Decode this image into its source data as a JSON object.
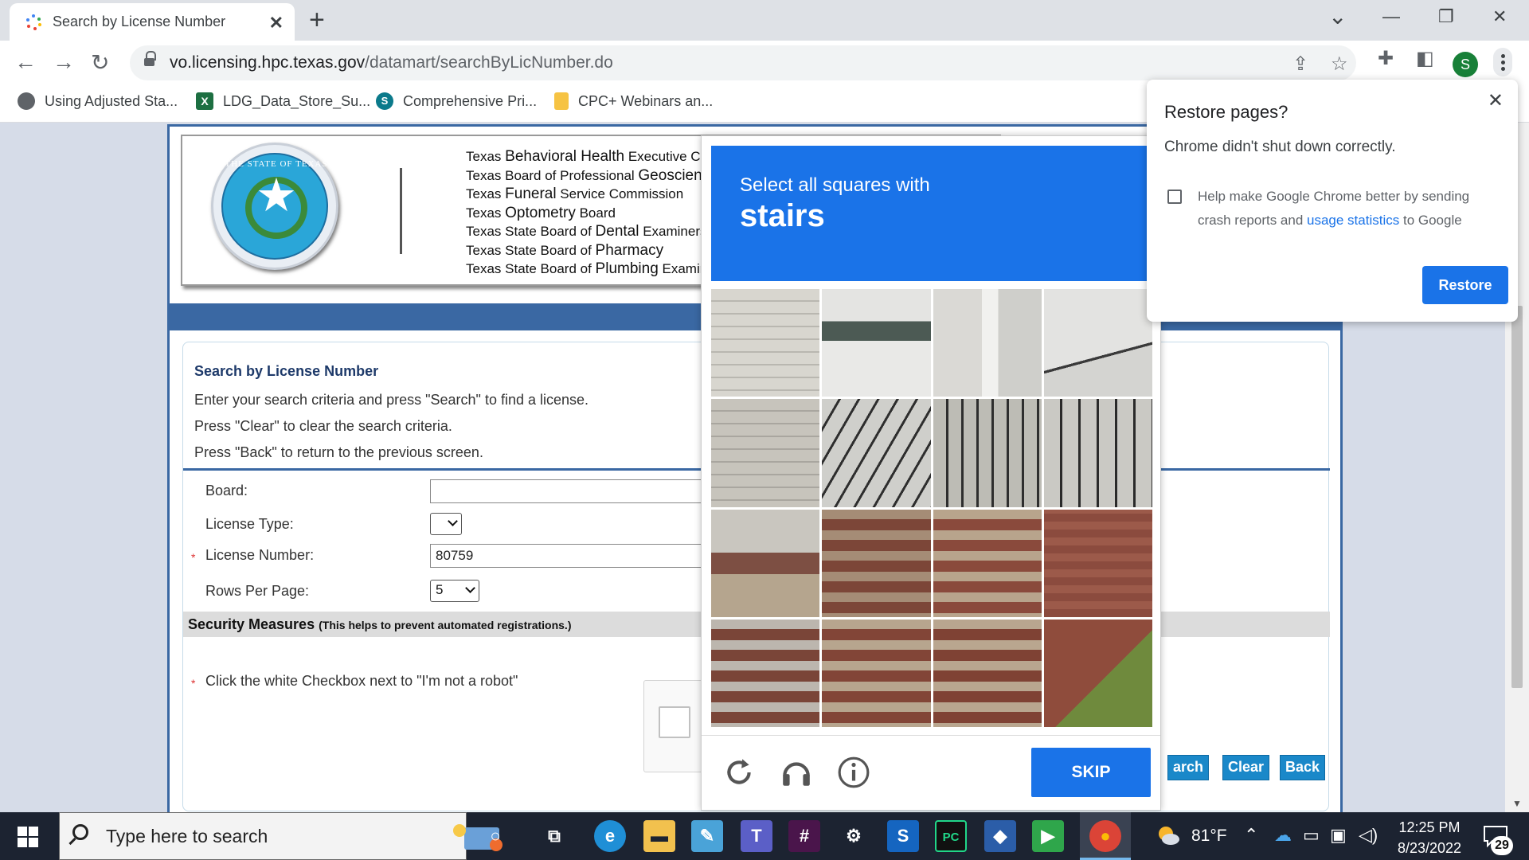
{
  "browser": {
    "tab_title": "Search by License Number",
    "tab_close": "✕",
    "new_tab": "+",
    "url_domain": "vo.licensing.hpc.texas.gov",
    "url_path": "/datamart/searchByLicNumber.do",
    "profile_initial": "S",
    "window_controls": {
      "minimize": "—",
      "restore": "❐",
      "close": "✕",
      "tab_search": "⌄"
    }
  },
  "bookmarks": [
    {
      "label": "Using Adjusted Sta...",
      "icon": "globe-icon",
      "color": "#5f6368"
    },
    {
      "label": "LDG_Data_Store_Su...",
      "icon": "excel-icon",
      "color": "#1d6f42"
    },
    {
      "label": "Comprehensive Pri...",
      "icon": "sharepoint-icon",
      "color": "#0b7a8b"
    },
    {
      "label": "CPC+ Webinars an...",
      "icon": "folder-icon",
      "color": "#f6c343"
    }
  ],
  "header": {
    "seal_text": "THE STATE OF TEXAS",
    "boards": [
      {
        "pre": "Texas ",
        "big": "Behavioral Health",
        "post": " Executive Council"
      },
      {
        "pre": "Texas Board of Professional ",
        "big": "Geoscientists",
        "post": ""
      },
      {
        "pre": "Texas ",
        "big": "Funeral",
        "post": " Service Commission"
      },
      {
        "pre": "Texas ",
        "big": "Optometry",
        "post": " Board"
      },
      {
        "pre": "Texas State Board of ",
        "big": "Dental",
        "post": " Examiners"
      },
      {
        "pre": "Texas State Board of ",
        "big": "Pharmacy",
        "post": ""
      },
      {
        "pre": "Texas State Board of ",
        "big": "Plumbing",
        "post": " Examiners"
      }
    ]
  },
  "form": {
    "title": "Search by License Number",
    "instructions": [
      "Enter your search criteria and press \"Search\" to find a license.",
      "Press \"Clear\" to clear the search criteria.",
      "Press \"Back\" to return to the previous screen."
    ],
    "board_label": "Board:",
    "board_value": "",
    "license_type_label": "License Type:",
    "license_type_value": "",
    "license_number_label": "License Number:",
    "license_number_value": "80759",
    "rows_label": "Rows Per Page:",
    "rows_value": "5",
    "security_title": "Security Measures",
    "security_sub": "(This helps to prevent automated registrations.)",
    "robot_instruction": "Click the white Checkbox next to \"I'm not a robot\"",
    "required_mark": "*",
    "buttons": {
      "search": "arch",
      "clear": "Clear",
      "back": "Back"
    }
  },
  "captcha": {
    "instruction": "Select all squares with",
    "target": "stairs",
    "skip_label": "SKIP",
    "icons": [
      "reload-icon",
      "audio-icon",
      "info-icon"
    ]
  },
  "restore_popup": {
    "title": "Restore pages?",
    "message": "Chrome didn't shut down correctly.",
    "help_pre": "Help make Google Chrome better by sending crash reports and ",
    "help_link": "usage statistics",
    "help_post": " to Google",
    "button": "Restore",
    "close": "✕"
  },
  "taskbar": {
    "search_placeholder": "Type here to search",
    "weather": "81°F",
    "time": "12:25 PM",
    "date": "8/23/2022",
    "notifications": "29",
    "apps": [
      {
        "name": "cortana-icon",
        "glyph": "○",
        "color": "#1c2331"
      },
      {
        "name": "task-view-icon",
        "glyph": "⧉",
        "color": "#1c2331"
      },
      {
        "name": "edge-icon",
        "glyph": "e",
        "color": "#1f8fd6"
      },
      {
        "name": "file-explorer-icon",
        "glyph": "▬",
        "color": "#f2c14e"
      },
      {
        "name": "notepad-icon",
        "glyph": "✎",
        "color": "#4aa3d8"
      },
      {
        "name": "teams-icon",
        "glyph": "T",
        "color": "#5b5fc7"
      },
      {
        "name": "slack-icon",
        "glyph": "#",
        "color": "#4a154b"
      },
      {
        "name": "settings-icon",
        "glyph": "⚙",
        "color": "#1c2331"
      },
      {
        "name": "sharepoint-app-icon",
        "glyph": "S",
        "color": "#1565c0"
      },
      {
        "name": "pycharm-icon",
        "glyph": "PC",
        "color": "#111111"
      },
      {
        "name": "git-icon",
        "glyph": "◆",
        "color": "#2b5da8"
      },
      {
        "name": "media-player-icon",
        "glyph": "▶",
        "color": "#2fa64b"
      },
      {
        "name": "chrome-icon",
        "glyph": "●",
        "color": "#db4437"
      }
    ]
  }
}
